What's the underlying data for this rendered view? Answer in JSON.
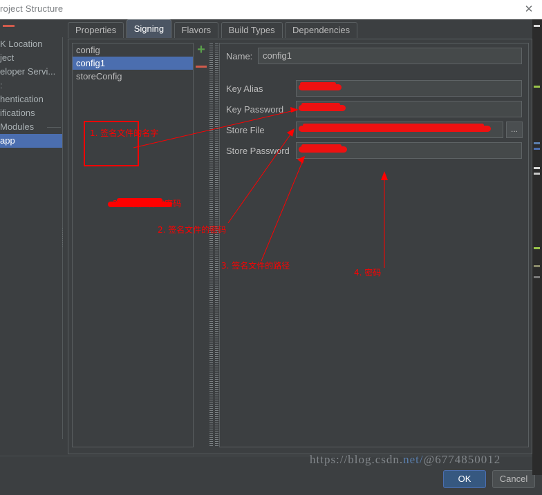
{
  "window": {
    "title": "roject Structure",
    "close_icon": "close-icon"
  },
  "sidebar": {
    "collapse_icon": "minus-icon",
    "items": [
      {
        "label": "K Location",
        "selected": false,
        "group": false
      },
      {
        "label": "ject",
        "selected": false,
        "group": false
      },
      {
        "label": "eloper Servi...",
        "selected": false,
        "group": false
      },
      {
        "label": ":",
        "selected": false,
        "group": false
      },
      {
        "label": "hentication",
        "selected": false,
        "group": false
      },
      {
        "label": "ifications",
        "selected": false,
        "group": false
      },
      {
        "label": "Modules",
        "selected": false,
        "group": true
      },
      {
        "label": "app",
        "selected": true,
        "group": false
      }
    ]
  },
  "tabs": [
    {
      "label": "Properties",
      "active": false
    },
    {
      "label": "Signing",
      "active": true
    },
    {
      "label": "Flavors",
      "active": false
    },
    {
      "label": "Build Types",
      "active": false
    },
    {
      "label": "Dependencies",
      "active": false
    }
  ],
  "config_list": {
    "items": [
      {
        "label": "config",
        "selected": false
      },
      {
        "label": "config1",
        "selected": true
      },
      {
        "label": "storeConfig",
        "selected": false
      }
    ],
    "add_icon": "plus-icon",
    "remove_icon": "minus-icon"
  },
  "form": {
    "name": {
      "label": "Name:",
      "value": "config1"
    },
    "key_alias": {
      "label": "Key Alias",
      "value": "",
      "redacted": true
    },
    "key_password": {
      "label": "Key Password",
      "value": "",
      "redacted": true
    },
    "store_file": {
      "label": "Store File",
      "value": "",
      "redacted": true,
      "browse_label": "..."
    },
    "store_password": {
      "label": "Store Password",
      "value": "",
      "redacted": true
    }
  },
  "annotations": [
    {
      "id": "ann1",
      "text": "1. 签名文件的名字"
    },
    {
      "id": "ann2a",
      "text": "2. 签名文件的密码"
    },
    {
      "id": "ann2b",
      "text": "2. 签名文件的密码"
    },
    {
      "id": "ann3",
      "text": "3. 签名文件的路径"
    },
    {
      "id": "ann4",
      "text": "4. 密码"
    }
  ],
  "buttons": {
    "ok": "OK",
    "cancel": "Cancel"
  },
  "watermark": {
    "part1": "https://blog.csdn.",
    "part2": "net/",
    "part3": "@6774850012"
  },
  "colors": {
    "background": "#3c3f41",
    "selection": "#4b6eaf",
    "annotation": "#ff0000",
    "accent_green": "#5a9e4b",
    "accent_red": "#d15b4c",
    "primary_button": "#365880"
  }
}
